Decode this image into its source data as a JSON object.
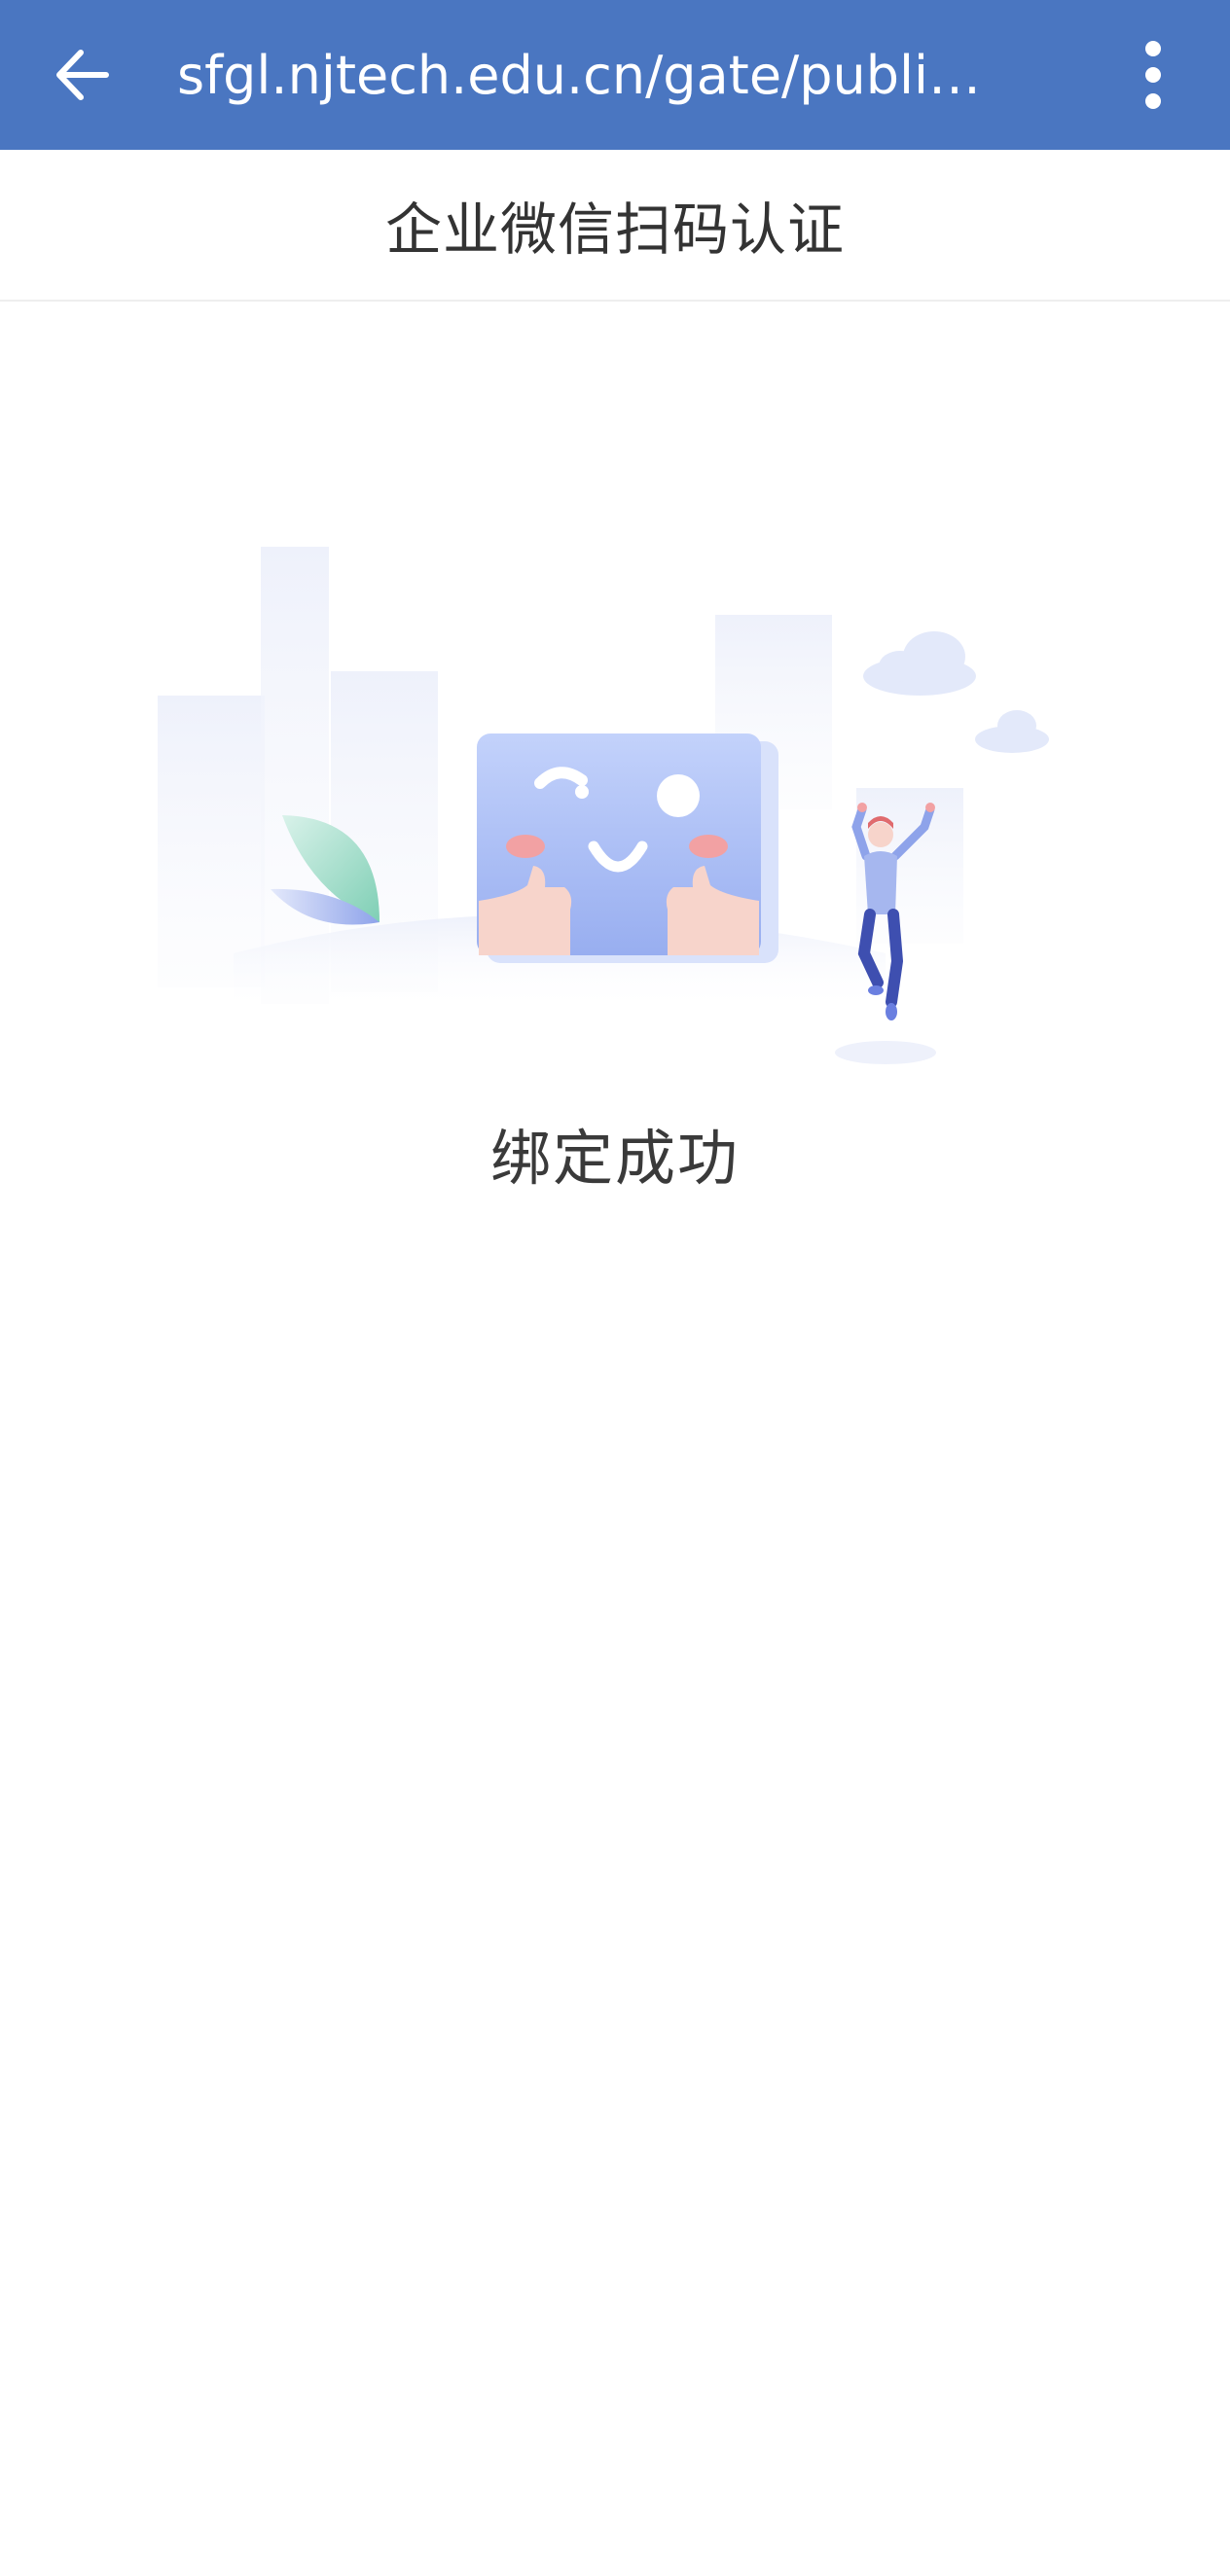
{
  "browser": {
    "url": "sfgl.njtech.edu.cn/gate/publi…",
    "back_icon": "arrow-left-icon",
    "menu_icon": "more-vertical-icon"
  },
  "header": {
    "title": "企业微信扫码认证"
  },
  "result": {
    "message": "绑定成功",
    "illustration": "success-illustration"
  },
  "colors": {
    "toolbar": "#4a76c1",
    "title_text": "#333333",
    "accent_face": "#a9bdf4"
  }
}
